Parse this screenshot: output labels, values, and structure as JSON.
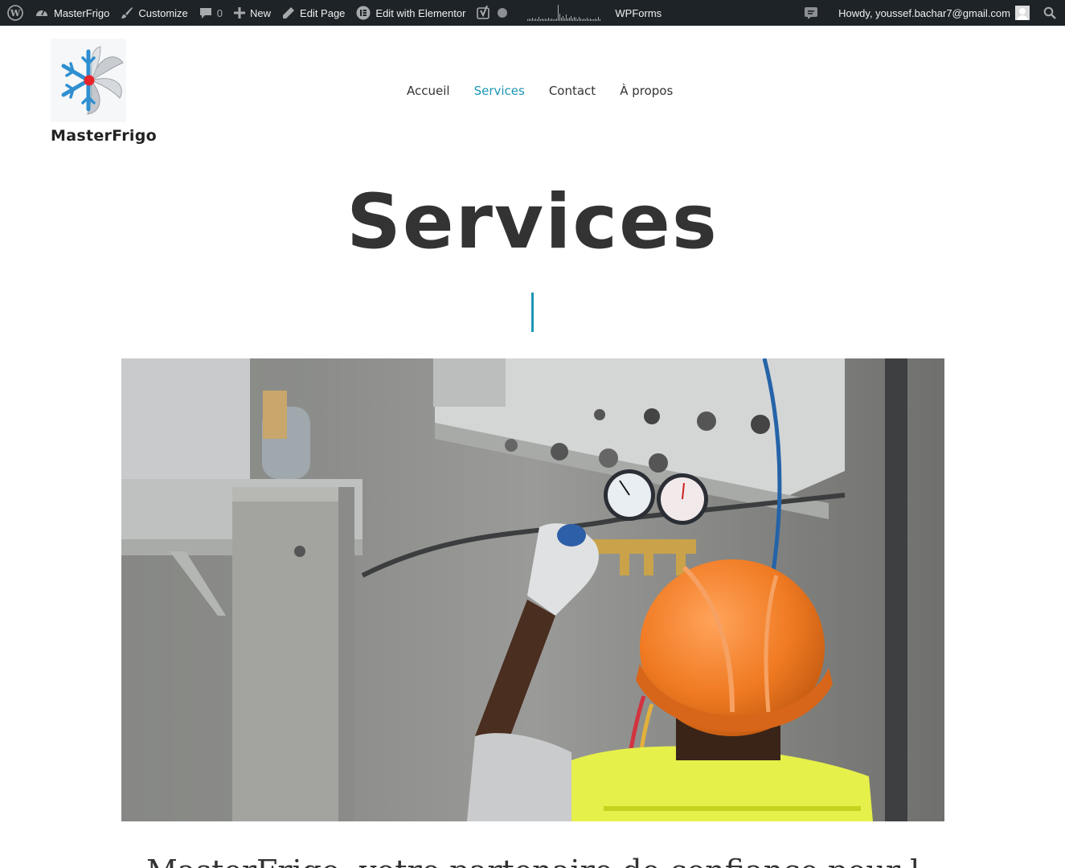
{
  "admin_bar": {
    "site_name": "MasterFrigo",
    "customize": "Customize",
    "comments_count": "0",
    "new": "New",
    "edit_page": "Edit Page",
    "edit_elementor": "Edit with Elementor",
    "wpforms": "WPForms",
    "howdy": "Howdy, youssef.bachar7@gmail.com"
  },
  "header": {
    "site_title": "MasterFrigo",
    "nav": [
      {
        "label": "Accueil",
        "active": false
      },
      {
        "label": "Services",
        "active": true
      },
      {
        "label": "Contact",
        "active": false
      },
      {
        "label": "À propos",
        "active": false
      }
    ]
  },
  "page": {
    "title": "Services",
    "intro_text": "MasterFrigo, votre partenaire de confiance pour les solutions de froid"
  },
  "colors": {
    "accent": "#1c97b5",
    "admin_bar_bg": "#1d2327",
    "text": "#333333"
  },
  "icons": [
    "wordpress-icon",
    "dashboard-icon",
    "brush-icon",
    "comment-icon",
    "plus-icon",
    "pencil-icon",
    "elementor-icon",
    "yoast-icon",
    "status-dot-icon",
    "notification-icon",
    "avatar-icon",
    "search-icon"
  ]
}
